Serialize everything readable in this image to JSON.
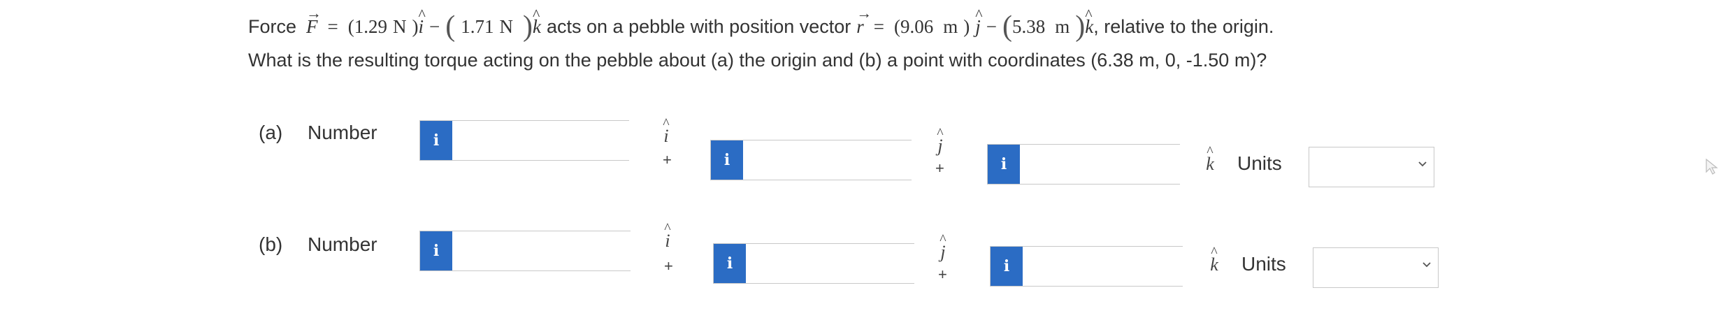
{
  "question": {
    "force_label": "Force",
    "force_symbol": "F",
    "force_i_value": "1.29",
    "force_i_unit": "N",
    "force_k_value": "1.71",
    "force_k_unit": "N",
    "acts_text": "acts on a pebble with position vector",
    "position_symbol": "r",
    "pos_j_value": "9.06",
    "pos_j_unit": "m",
    "pos_k_value": "5.38",
    "pos_k_unit": "m",
    "relative_text": ", relative to the origin.",
    "line2": "What is the resulting torque acting on the pebble about (a) the origin and (b) a point with coordinates (6.38 m, 0, -1.50 m)?"
  },
  "unit_symbols": {
    "i": "i",
    "j": "j",
    "k": "k",
    "plus": "+",
    "minus": "−",
    "equals": "=",
    "info": "i"
  },
  "part_a": {
    "label": "(a)",
    "number_label": "Number",
    "i_value": "",
    "j_value": "",
    "k_value": "",
    "units_label": "Units",
    "units_value": ""
  },
  "part_b": {
    "label": "(b)",
    "number_label": "Number",
    "i_value": "",
    "j_value": "",
    "k_value": "",
    "units_label": "Units",
    "units_value": ""
  },
  "colors": {
    "info_button": "#2b6cc4",
    "border": "#c8c8c8",
    "text": "#333333"
  },
  "icons": {
    "info": "info-icon",
    "dropdown": "chevron-down-icon",
    "cursor": "mouse-pointer-icon"
  }
}
